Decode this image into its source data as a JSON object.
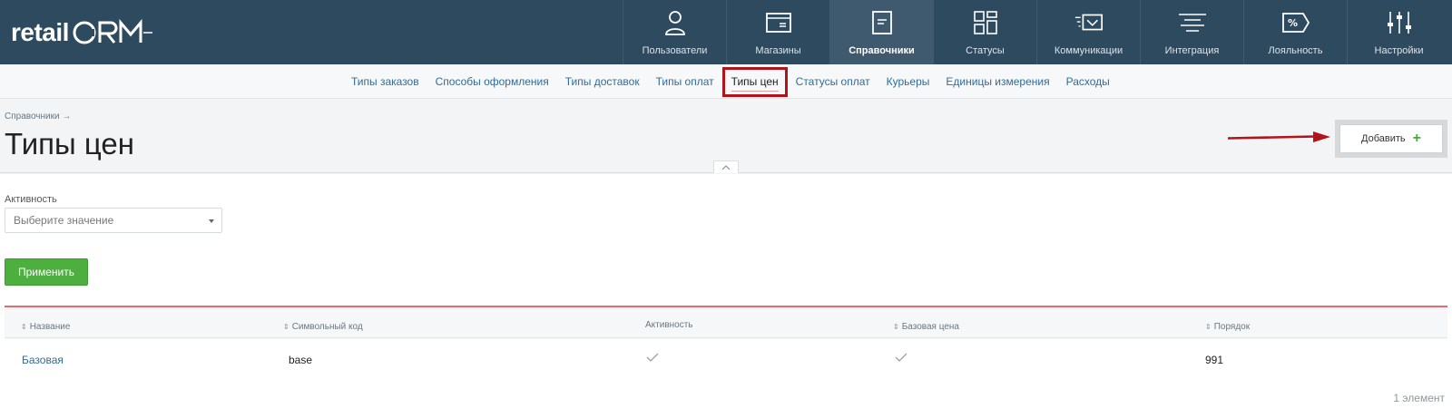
{
  "app": {
    "logo_text": "retail",
    "logo_suffix": "CRM"
  },
  "nav": {
    "items": [
      {
        "label": "Пользователи",
        "icon": "user-icon"
      },
      {
        "label": "Магазины",
        "icon": "store-icon"
      },
      {
        "label": "Справочники",
        "icon": "reference-icon",
        "active": true
      },
      {
        "label": "Статусы",
        "icon": "status-icon"
      },
      {
        "label": "Коммуникации",
        "icon": "communication-icon"
      },
      {
        "label": "Интеграция",
        "icon": "integration-icon"
      },
      {
        "label": "Лояльность",
        "icon": "loyalty-icon"
      },
      {
        "label": "Настройки",
        "icon": "settings-icon"
      }
    ]
  },
  "subnav": {
    "items": [
      "Типы заказов",
      "Способы оформления",
      "Типы доставок",
      "Типы оплат",
      "Типы цен",
      "Статусы оплат",
      "Курьеры",
      "Единицы измерения",
      "Расходы"
    ],
    "active_index": 4
  },
  "page": {
    "breadcrumb": "Справочники →",
    "title": "Типы цен",
    "add_label": "Добавить",
    "add_symbol": "+"
  },
  "filter": {
    "label": "Активность",
    "placeholder": "Выберите значение",
    "apply_label": "Применить"
  },
  "table": {
    "columns": [
      "Название",
      "Символьный код",
      "Активность",
      "Базовая цена",
      "Порядок"
    ],
    "sort_symbol": "⇕",
    "rows": [
      {
        "name": "Базовая",
        "code": "base",
        "active": true,
        "base_price": true,
        "order": "991"
      }
    ],
    "count": "1 элемент"
  },
  "colors": {
    "header_bg": "#2e4a5f",
    "accent_green": "#4caf3e",
    "link_blue": "#2f6b9a",
    "highlight_red": "#b1141b"
  }
}
